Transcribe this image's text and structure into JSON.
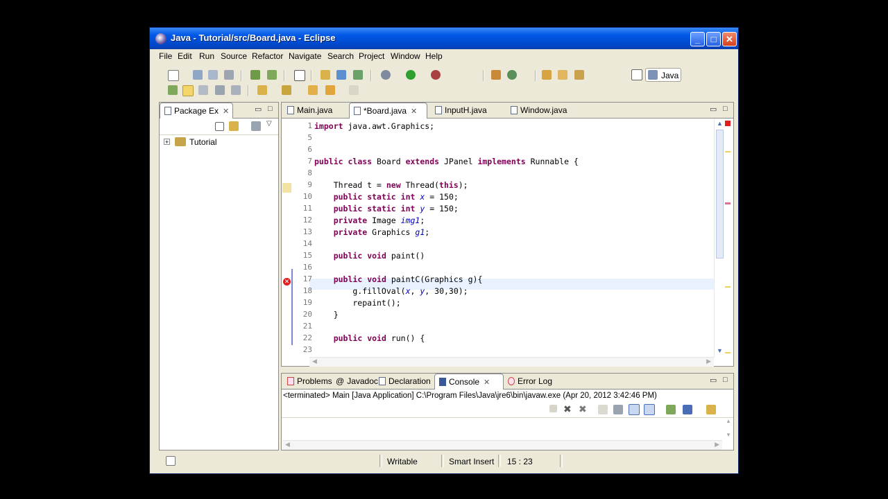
{
  "window": {
    "title": "Java - Tutorial/src/Board.java - Eclipse",
    "min": "_",
    "max": "□",
    "close": "✕"
  },
  "menu": [
    "File",
    "Edit",
    "Run",
    "Source",
    "Refactor",
    "Navigate",
    "Search",
    "Project",
    "Window",
    "Help"
  ],
  "perspective": {
    "label": "Java"
  },
  "package_explorer": {
    "tab": "Package Ex",
    "close": "✕",
    "tree": [
      {
        "expander": "+",
        "label": "Tutorial"
      }
    ]
  },
  "editor": {
    "tabs": [
      {
        "label": "Main.java"
      },
      {
        "label": "*Board.java",
        "close": "✕"
      },
      {
        "label": "InputH.java"
      },
      {
        "label": "Window.java"
      }
    ],
    "lines": [
      {
        "n": "1",
        "code": "import java.awt.Graphics;"
      },
      {
        "n": "5",
        "code": ""
      },
      {
        "n": "6",
        "code": ""
      },
      {
        "n": "7",
        "code": "public class Board extends JPanel implements Runnable {"
      },
      {
        "n": "8",
        "code": ""
      },
      {
        "n": "9",
        "code": "    Thread t = new Thread(this);"
      },
      {
        "n": "10",
        "code": "    public static int x = 150;"
      },
      {
        "n": "11",
        "code": "    public static int y = 150;"
      },
      {
        "n": "12",
        "code": "    private Image img1;"
      },
      {
        "n": "13",
        "code": "    private Graphics g1;"
      },
      {
        "n": "14",
        "code": ""
      },
      {
        "n": "15",
        "code": "    public void paint()"
      },
      {
        "n": "16",
        "code": ""
      },
      {
        "n": "17",
        "code": "    public void paintC(Graphics g){"
      },
      {
        "n": "18",
        "code": "        g.fillOval(x, y, 30,30);"
      },
      {
        "n": "19",
        "code": "        repaint();"
      },
      {
        "n": "20",
        "code": "    }"
      },
      {
        "n": "21",
        "code": ""
      },
      {
        "n": "22",
        "code": "    public void run() {"
      },
      {
        "n": "23",
        "code": ""
      }
    ]
  },
  "bottom": {
    "tabs": [
      "Problems",
      "Javadoc",
      "Declaration",
      "Console",
      "Error Log"
    ],
    "console_close": "✕",
    "console_header": "<terminated> Main [Java Application] C:\\Program Files\\Java\\jre6\\bin\\javaw.exe (Apr 20, 2012 3:42:46 PM)"
  },
  "status": {
    "writable": "Writable",
    "insert_mode": "Smart Insert",
    "position": "15 : 23"
  },
  "colors": {
    "keyword": "#7f0055",
    "field": "#0000c0",
    "title_bar": "#0058e6",
    "error": "#e02020"
  }
}
